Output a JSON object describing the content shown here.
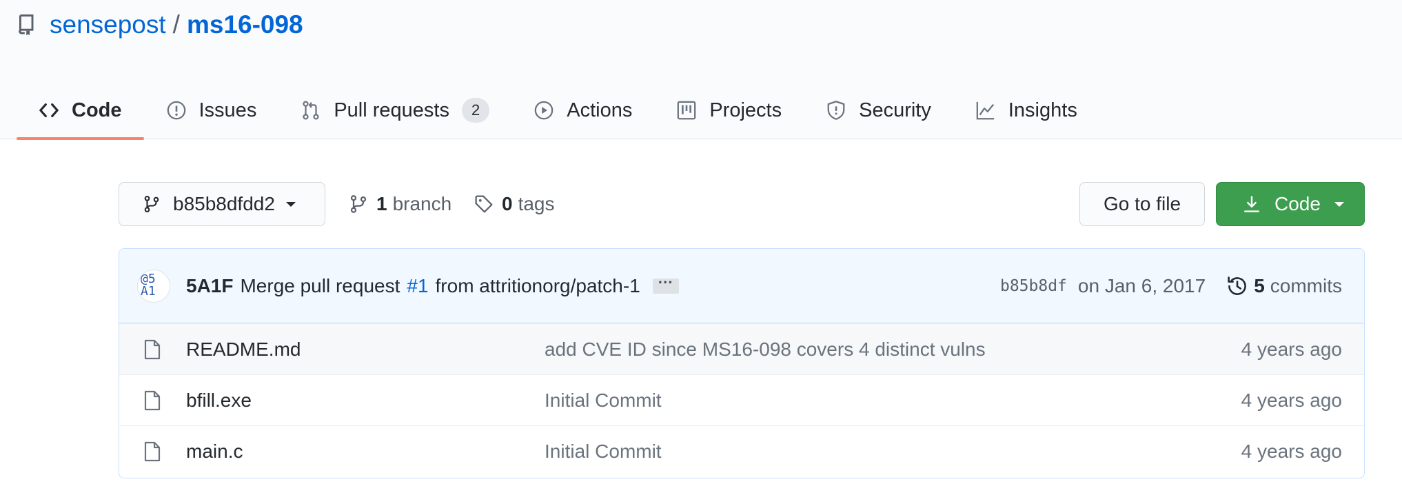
{
  "repo": {
    "owner": "sensepost",
    "separator": "/",
    "name": "ms16-098"
  },
  "tabs": [
    {
      "label": "Code",
      "icon": "code-icon",
      "selected": true
    },
    {
      "label": "Issues",
      "icon": "issue-icon"
    },
    {
      "label": "Pull requests",
      "icon": "pull-request-icon",
      "count": "2"
    },
    {
      "label": "Actions",
      "icon": "play-icon"
    },
    {
      "label": "Projects",
      "icon": "project-icon"
    },
    {
      "label": "Security",
      "icon": "shield-icon"
    },
    {
      "label": "Insights",
      "icon": "graph-icon"
    }
  ],
  "file_nav": {
    "branch": "b85b8dfdd2",
    "branch_count": "1",
    "branch_label": "branch",
    "tag_count": "0",
    "tag_label": "tags",
    "goto_file": "Go to file",
    "code_button": "Code"
  },
  "commit": {
    "avatar_text": "@5 A1",
    "author": "5A1F",
    "message_prefix": "Merge pull request",
    "pr_link": "#1",
    "message_suffix": "from attritionorg/patch-1",
    "ellipsis": "···",
    "sha": "b85b8df",
    "date": "on Jan 6, 2017",
    "commit_count": "5",
    "commits_label": "commits"
  },
  "files": [
    {
      "name": "README.md",
      "message": "add CVE ID since MS16-098 covers 4 distinct vulns",
      "age": "4 years ago",
      "icon": "file-icon"
    },
    {
      "name": "bfill.exe",
      "message": "Initial Commit",
      "age": "4 years ago",
      "icon": "file-icon"
    },
    {
      "name": "main.c",
      "message": "Initial Commit",
      "age": "4 years ago",
      "icon": "file-icon"
    }
  ],
  "colors": {
    "link": "#0366d6",
    "tab_underline": "#f9826c",
    "code_button": "#3e9e4f",
    "commit_bar": "#f1f8ff"
  }
}
